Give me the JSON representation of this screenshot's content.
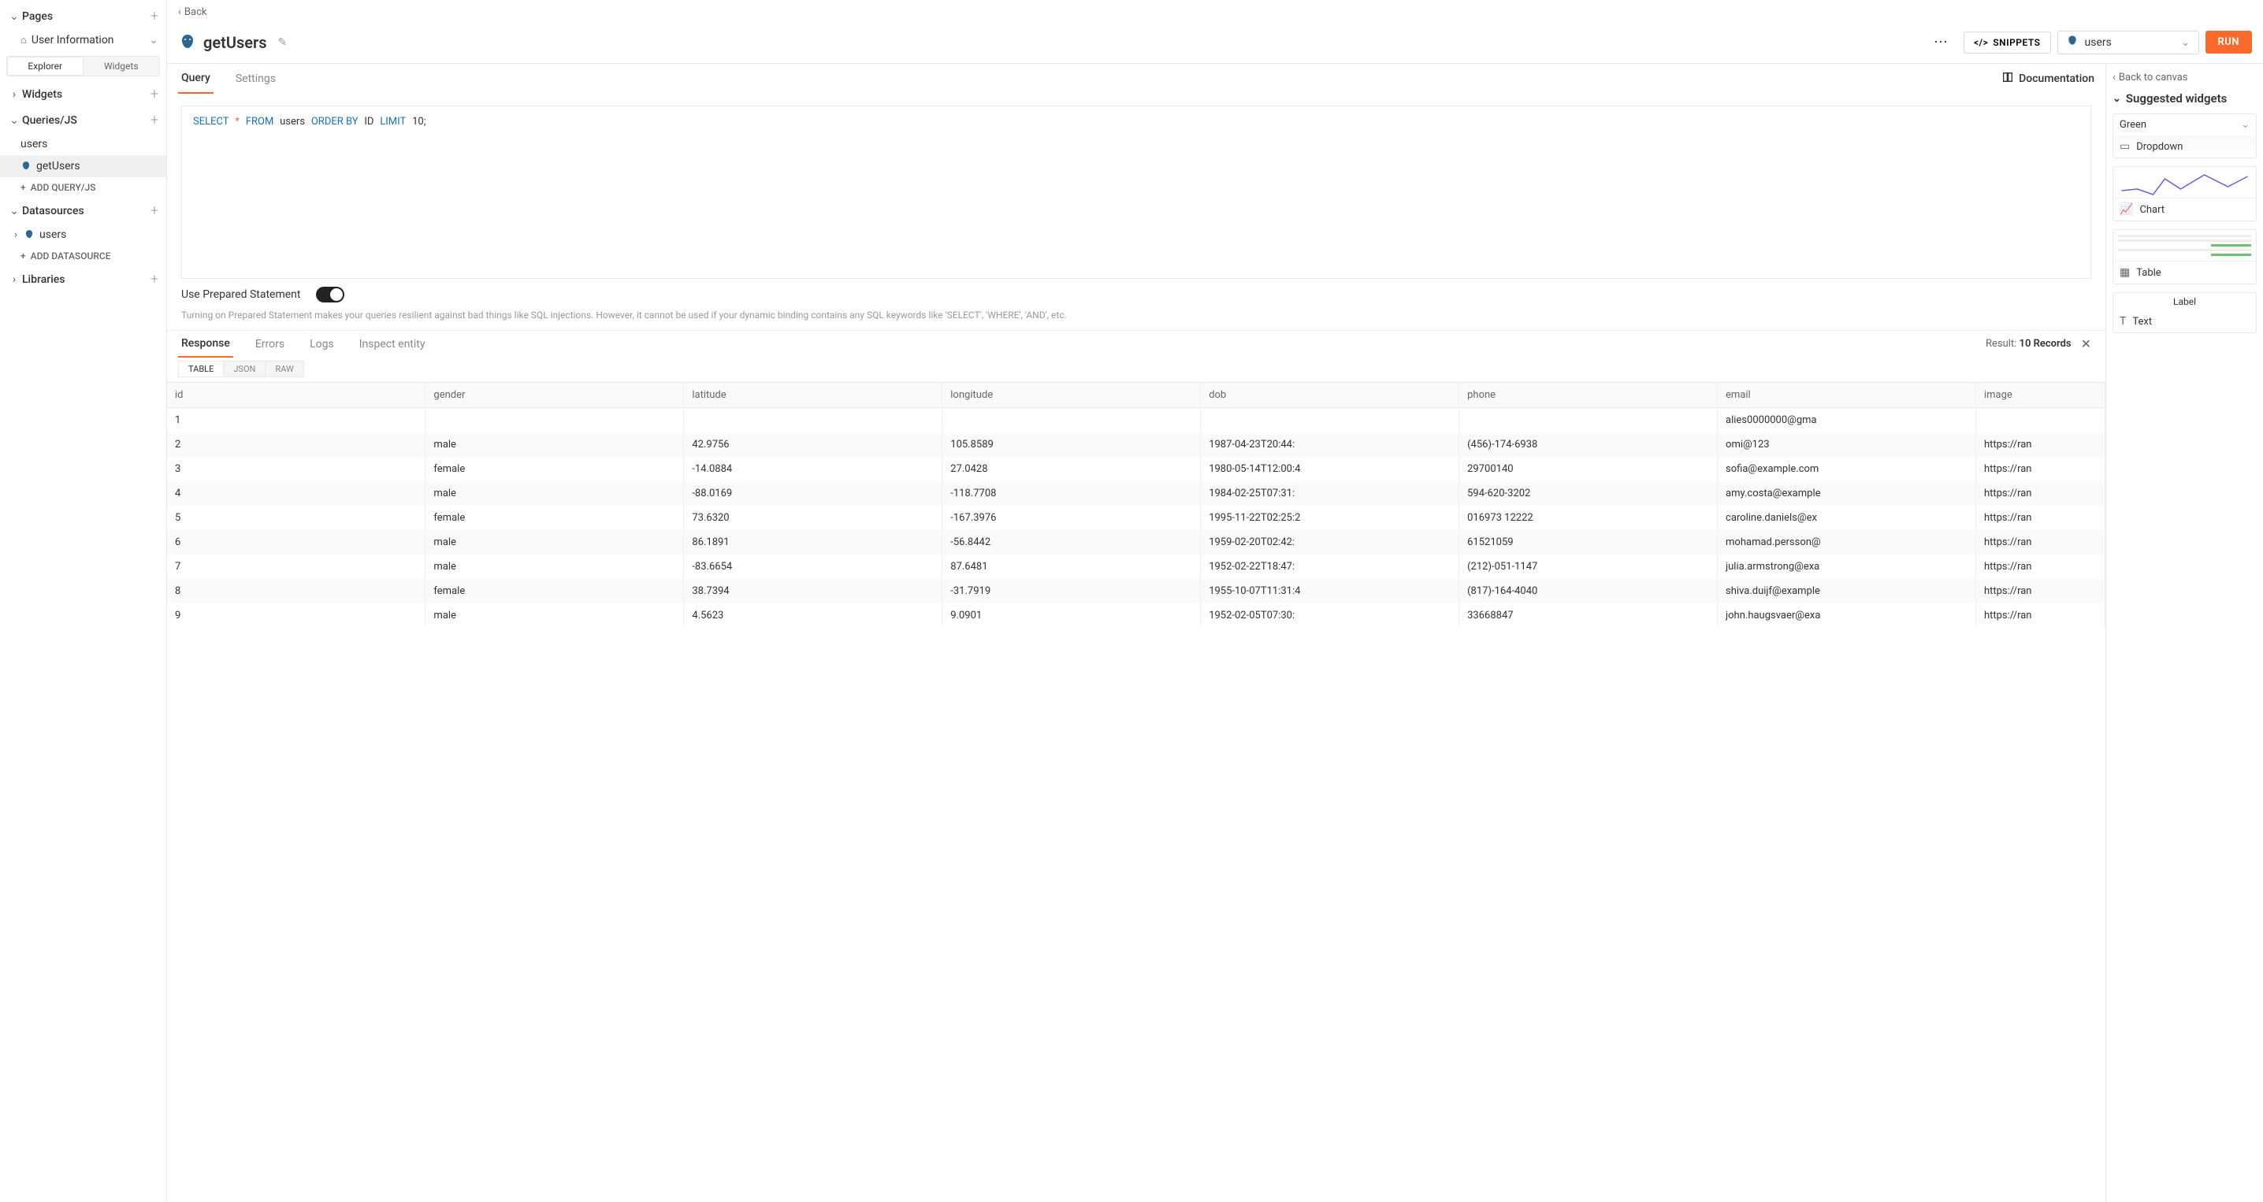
{
  "sidebar": {
    "pages_label": "Pages",
    "page_item": "User Information",
    "seg_tabs": [
      "Explorer",
      "Widgets"
    ],
    "widgets_label": "Widgets",
    "queries_label": "Queries/JS",
    "query_items": [
      "users",
      "getUsers"
    ],
    "add_query": "ADD QUERY/JS",
    "datasources_label": "Datasources",
    "ds_item": "users",
    "add_ds": "ADD DATASOURCE",
    "libraries_label": "Libraries"
  },
  "header": {
    "back": "Back",
    "title": "getUsers",
    "snippets": "SNIPPETS",
    "datasource": "users",
    "run": "RUN"
  },
  "sub_tabs": {
    "query": "Query",
    "settings": "Settings",
    "doc": "Documentation"
  },
  "sql": {
    "select": "SELECT",
    "star": "*",
    "from": "FROM",
    "table": "users",
    "order": "ORDER BY",
    "id": "ID",
    "limit": "LIMIT",
    "n": "10",
    "semi": ";"
  },
  "prepared": {
    "label": "Use Prepared Statement",
    "hint": "Turning on Prepared Statement makes your queries resilient against bad things like SQL injections. However, it cannot be used if your dynamic binding contains any SQL keywords like 'SELECT', 'WHERE', 'AND', etc."
  },
  "response": {
    "tabs": [
      "Response",
      "Errors",
      "Logs",
      "Inspect entity"
    ],
    "result_prefix": "Result:",
    "result_value": "10 Records",
    "view_tabs": [
      "TABLE",
      "JSON",
      "RAW"
    ]
  },
  "table": {
    "columns": [
      "id",
      "gender",
      "latitude",
      "longitude",
      "dob",
      "phone",
      "email",
      "image"
    ],
    "rows": [
      {
        "id": "1",
        "gender": "",
        "latitude": "",
        "longitude": "",
        "dob": "",
        "phone": "",
        "email": "alies0000000@gma",
        "image": ""
      },
      {
        "id": "2",
        "gender": "male",
        "latitude": "42.9756",
        "longitude": "105.8589",
        "dob": "1987-04-23T20:44:",
        "phone": "(456)-174-6938",
        "email": "omi@123",
        "image": "https://ran"
      },
      {
        "id": "3",
        "gender": "female",
        "latitude": "-14.0884",
        "longitude": "27.0428",
        "dob": "1980-05-14T12:00:4",
        "phone": "29700140",
        "email": "sofia@example.com",
        "image": "https://ran"
      },
      {
        "id": "4",
        "gender": "male",
        "latitude": "-88.0169",
        "longitude": "-118.7708",
        "dob": "1984-02-25T07:31:",
        "phone": "594-620-3202",
        "email": "amy.costa@example",
        "image": "https://ran"
      },
      {
        "id": "5",
        "gender": "female",
        "latitude": "73.6320",
        "longitude": "-167.3976",
        "dob": "1995-11-22T02:25:2",
        "phone": "016973 12222",
        "email": "caroline.daniels@ex",
        "image": "https://ran"
      },
      {
        "id": "6",
        "gender": "male",
        "latitude": "86.1891",
        "longitude": "-56.8442",
        "dob": "1959-02-20T02:42:",
        "phone": "61521059",
        "email": "mohamad.persson@",
        "image": "https://ran"
      },
      {
        "id": "7",
        "gender": "male",
        "latitude": "-83.6654",
        "longitude": "87.6481",
        "dob": "1952-02-22T18:47:",
        "phone": "(212)-051-1147",
        "email": "julia.armstrong@exa",
        "image": "https://ran"
      },
      {
        "id": "8",
        "gender": "female",
        "latitude": "38.7394",
        "longitude": "-31.7919",
        "dob": "1955-10-07T11:31:4",
        "phone": "(817)-164-4040",
        "email": "shiva.duijf@example",
        "image": "https://ran"
      },
      {
        "id": "9",
        "gender": "male",
        "latitude": "4.5623",
        "longitude": "9.0901",
        "dob": "1952-02-05T07:30:",
        "phone": "33668847",
        "email": "john.haugsvaer@exa",
        "image": "https://ran"
      }
    ]
  },
  "right": {
    "back_canvas": "Back to canvas",
    "title": "Suggested widgets",
    "green_value": "Green",
    "items": {
      "dropdown": "Dropdown",
      "chart": "Chart",
      "table": "Table",
      "label_prev": "Label",
      "text": "Text"
    }
  }
}
